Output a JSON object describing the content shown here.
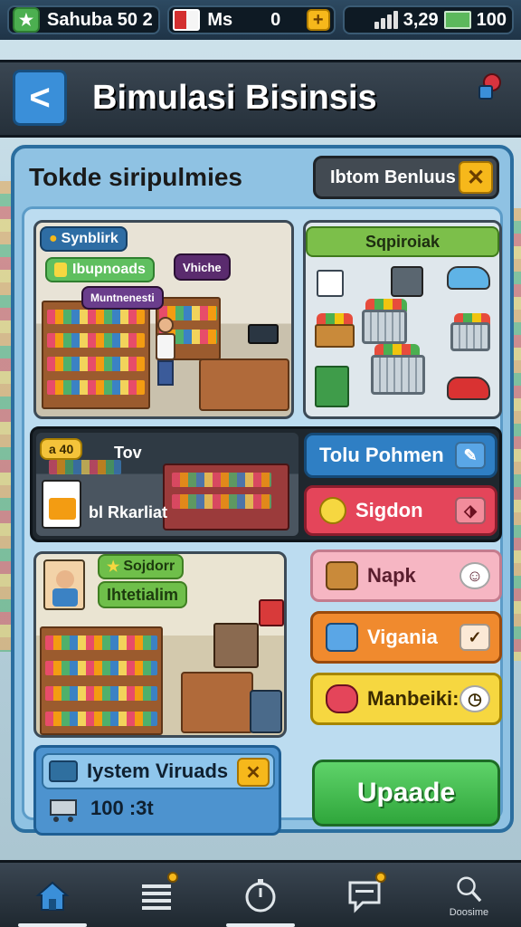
{
  "status_bar": {
    "player_name": "Sahuba 50 2",
    "currency_label": "Ms",
    "currency_value": "0",
    "plus_label": "+",
    "signal_text": "3,29",
    "battery_text": "100"
  },
  "header": {
    "back_label": "<",
    "title": "Bimulasi Bisinsis"
  },
  "panel": {
    "title": "Tokde siripulmies",
    "tab_label": "Ibtom Benluus",
    "tab_close": "✕"
  },
  "scene1": {
    "badge": "Synblirk",
    "tag": "Ibupnoads",
    "sign": "Vhiche",
    "shelf_sign": "Muntnenesti"
  },
  "scene2": {
    "title": "Sqpiroiak"
  },
  "scene3": {
    "badge": "a 40",
    "heading": "Tov",
    "subtitle": "bl Rkarliat"
  },
  "side_buttons": [
    {
      "label": "Tolu Pohmen",
      "style": "blue",
      "icon": "edit-icon"
    },
    {
      "label": "Sigdon",
      "style": "red",
      "icon": "coin-icon"
    },
    {
      "label": "Napk",
      "style": "pink",
      "icon": "basket-icon"
    },
    {
      "label": "Vigania",
      "style": "orange",
      "icon": "pill-icon"
    },
    {
      "label": "Manbeiki:",
      "style": "yellow",
      "icon": "capsule-icon"
    }
  ],
  "scene4": {
    "tag_line1": "Sojdorr",
    "tag_line2": "Ihtetialim"
  },
  "summary": {
    "title": "Iystem Viruads",
    "close": "✕",
    "value": "100 :3t"
  },
  "upgrade_label": "Upaade",
  "bottom_nav": [
    {
      "icon": "home-icon",
      "label": ""
    },
    {
      "icon": "list-icon",
      "label": ""
    },
    {
      "icon": "timer-icon",
      "label": ""
    },
    {
      "icon": "chat-icon",
      "label": ""
    },
    {
      "icon": "search-icon",
      "label": "Doosime"
    }
  ],
  "colors": {
    "accent_yellow": "#f6b81b",
    "upgrade_green": "#2fa63b",
    "panel_blue": "#8fc2e3"
  }
}
